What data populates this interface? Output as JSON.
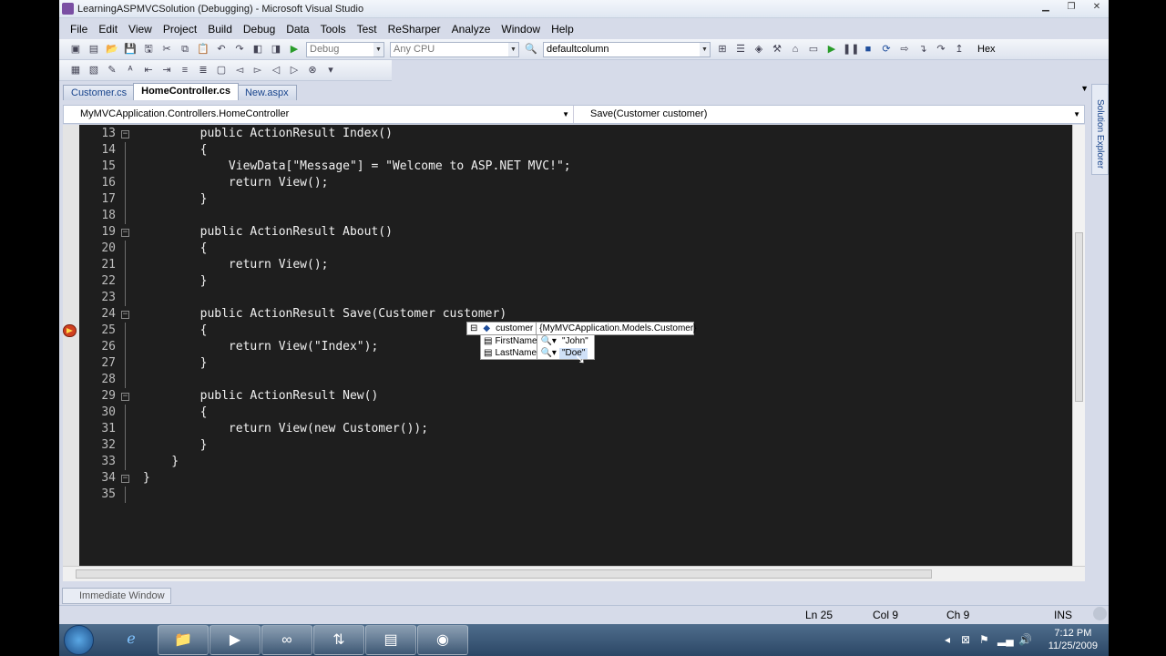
{
  "window": {
    "title": "LearningASPMVCSolution (Debugging) - Microsoft Visual Studio"
  },
  "menu": [
    "File",
    "Edit",
    "View",
    "Project",
    "Build",
    "Debug",
    "Data",
    "Tools",
    "Test",
    "ReSharper",
    "Analyze",
    "Window",
    "Help"
  ],
  "toolbar": {
    "config": "Debug",
    "platform": "Any CPU",
    "find_combo": "defaultcolumn",
    "hex_label": "Hex"
  },
  "tabs": [
    "Customer.cs",
    "HomeController.cs",
    "New.aspx"
  ],
  "nav": {
    "class_combo": "MyMVCApplication.Controllers.HomeController",
    "member_combo": "Save(Customer customer)"
  },
  "code_lines": [
    {
      "n": "13",
      "t": "        public ActionResult Index()"
    },
    {
      "n": "14",
      "t": "        {"
    },
    {
      "n": "15",
      "t": "            ViewData[\"Message\"] = \"Welcome to ASP.NET MVC!\";"
    },
    {
      "n": "16",
      "t": "            return View();"
    },
    {
      "n": "17",
      "t": "        }"
    },
    {
      "n": "18",
      "t": ""
    },
    {
      "n": "19",
      "t": "        public ActionResult About()"
    },
    {
      "n": "20",
      "t": "        {"
    },
    {
      "n": "21",
      "t": "            return View();"
    },
    {
      "n": "22",
      "t": "        }"
    },
    {
      "n": "23",
      "t": ""
    },
    {
      "n": "24",
      "t": "        public ActionResult Save(Customer customer)"
    },
    {
      "n": "25",
      "t": "        {"
    },
    {
      "n": "26",
      "t": "            return View(\"Index\");"
    },
    {
      "n": "27",
      "t": "        }"
    },
    {
      "n": "28",
      "t": ""
    },
    {
      "n": "29",
      "t": "        public ActionResult New()"
    },
    {
      "n": "30",
      "t": "        {"
    },
    {
      "n": "31",
      "t": "            return View(new Customer());"
    },
    {
      "n": "32",
      "t": "        }"
    },
    {
      "n": "33",
      "t": "    }"
    },
    {
      "n": "34",
      "t": "}"
    },
    {
      "n": "35",
      "t": ""
    }
  ],
  "datatip": {
    "name": "customer",
    "type": "{MyMVCApplication.Models.Customer}",
    "fields": [
      {
        "name": "FirstName",
        "value": "\"John\""
      },
      {
        "name": "LastName",
        "value": "\"Doe\""
      }
    ]
  },
  "side_panel": {
    "label": "Solution Explorer"
  },
  "bottom": {
    "immediate_window": "Immediate Window"
  },
  "status": {
    "ln": "Ln 25",
    "col": "Col 9",
    "ch": "Ch 9",
    "mode": "INS"
  },
  "clock": {
    "time": "7:12 PM",
    "date": "11/25/2009"
  }
}
